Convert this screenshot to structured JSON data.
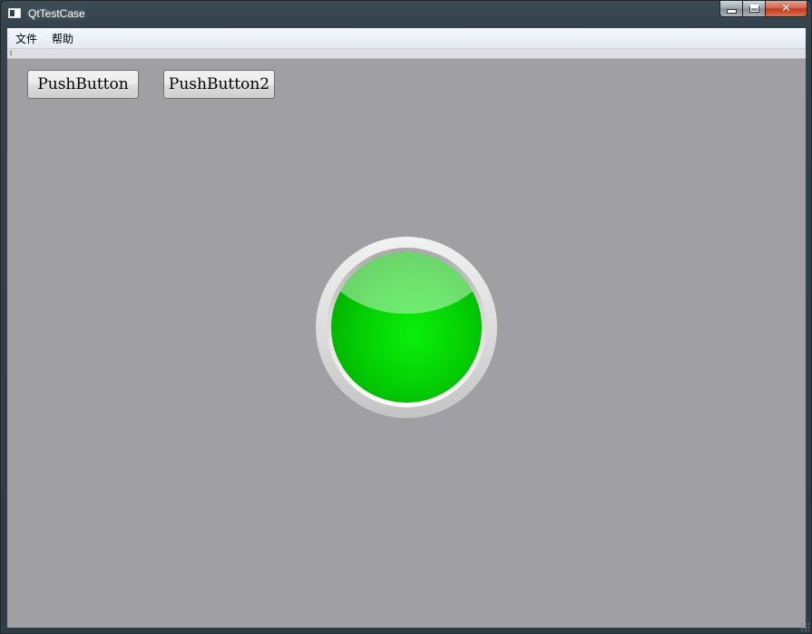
{
  "window": {
    "title": "QtTestCase",
    "controls": {
      "minimize": "minimize",
      "maximize": "maximize",
      "close": "✕"
    }
  },
  "menubar": {
    "items": [
      {
        "label": "文件"
      },
      {
        "label": "帮助"
      }
    ]
  },
  "buttons": [
    {
      "label": "PushButton"
    },
    {
      "label": "PushButton2"
    }
  ],
  "indicator": {
    "state": "on",
    "color": "#00dd00"
  },
  "colors": {
    "client_background": "#a09fa4",
    "menubar": "#eaeff6",
    "lamp_green": "#05d905"
  }
}
